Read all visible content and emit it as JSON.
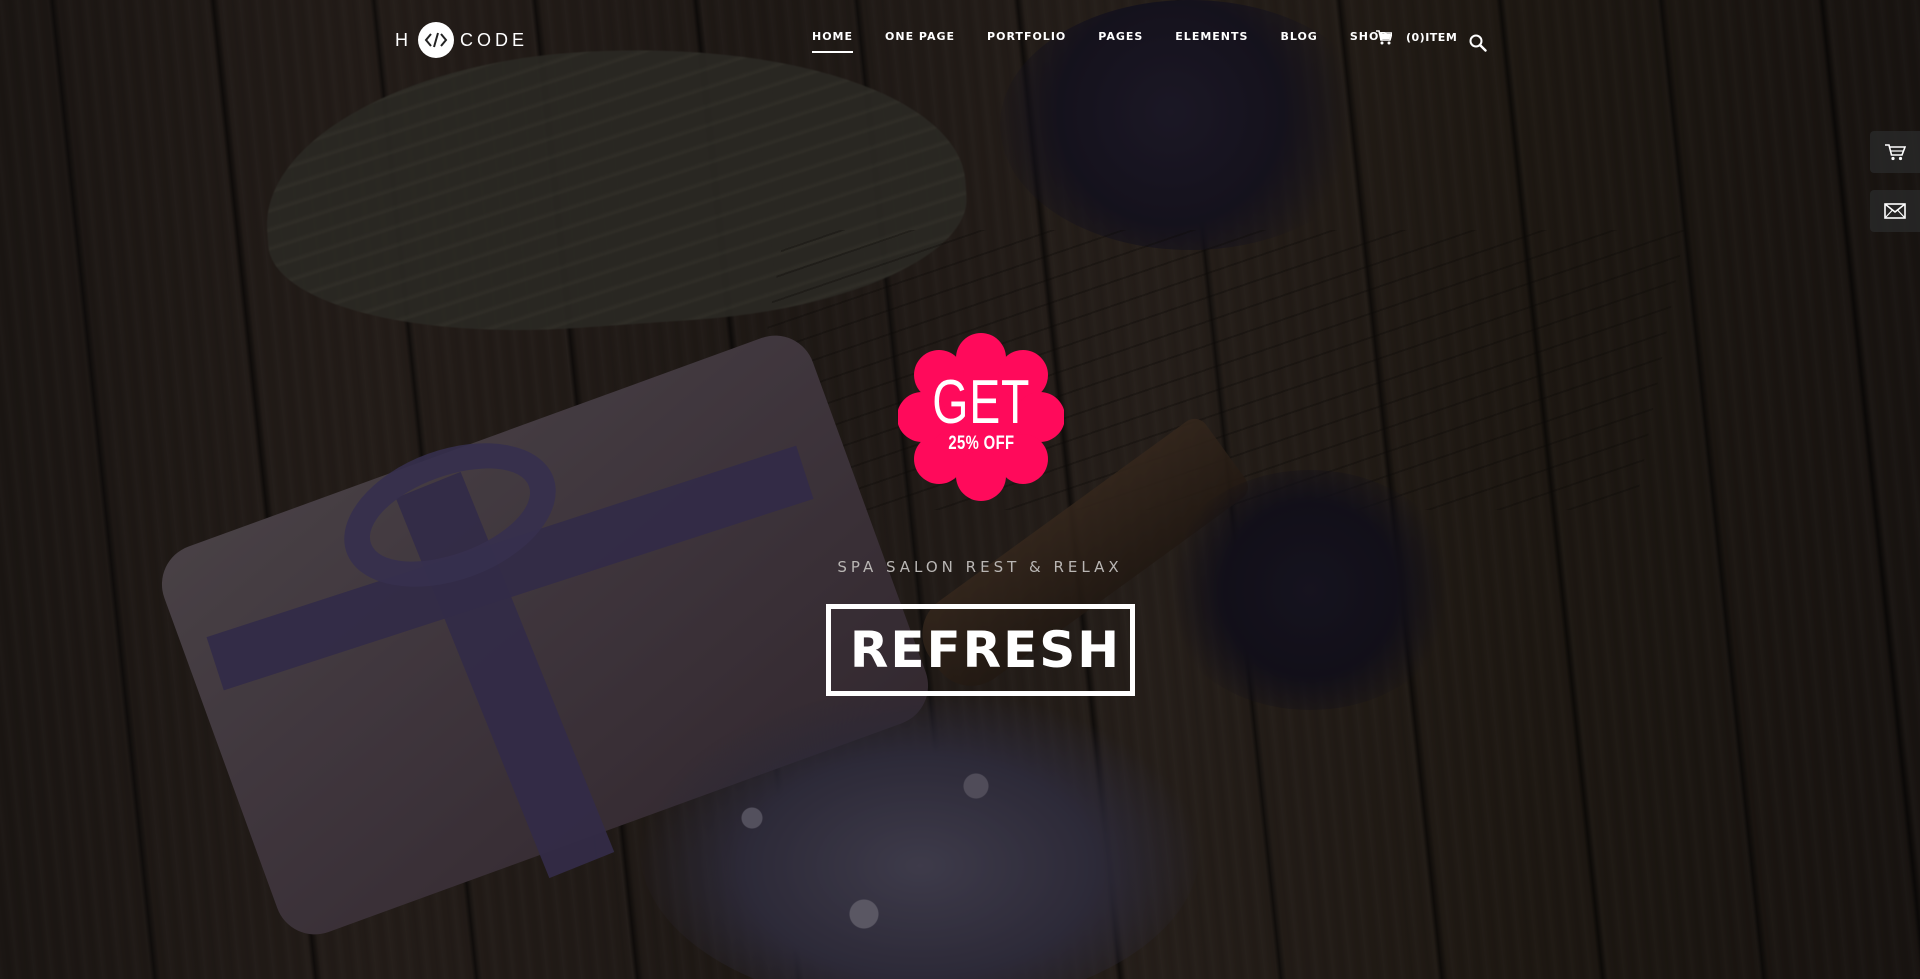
{
  "brand": {
    "left": "H",
    "right": "CODE"
  },
  "nav": {
    "items": [
      {
        "label": "HOME",
        "active": true
      },
      {
        "label": "ONE PAGE"
      },
      {
        "label": "PORTFOLIO"
      },
      {
        "label": "PAGES"
      },
      {
        "label": "ELEMENTS"
      },
      {
        "label": "BLOG"
      },
      {
        "label": "SHOP"
      }
    ],
    "cart_label": "(0)ITEM"
  },
  "hero": {
    "badge_big": "GET",
    "badge_small": "25% OFF",
    "tagline": "SPA SALON REST & RELAX",
    "cta_label": "REFRESH"
  },
  "colors": {
    "badge": "#ff0a5b",
    "text": "#ffffff",
    "overlay": "rgba(0,0,0,0.42)",
    "side_button": "#282828"
  },
  "icons": {
    "logo": "code-brackets-icon",
    "cart": "cart-icon",
    "search": "search-icon",
    "side_cart": "cart-icon",
    "side_mail": "mail-icon"
  }
}
